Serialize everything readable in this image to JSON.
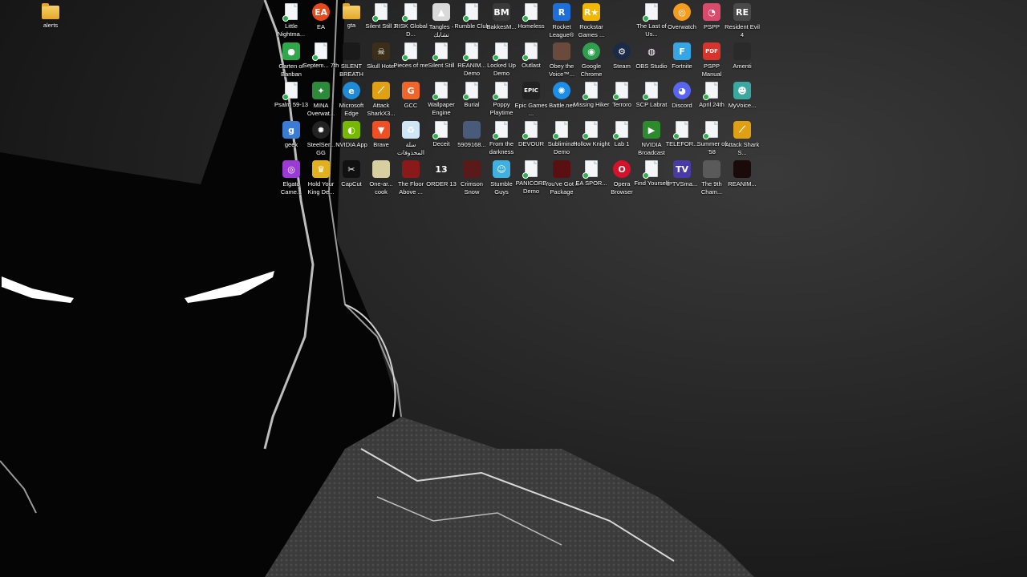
{
  "desktop": {
    "icons": [
      {
        "id": "alerts",
        "label": "alerts",
        "icon": "folder-icon",
        "kind": "folder",
        "color": "#e9b33a",
        "glyph": ""
      },
      {
        "id": "little-nightmares",
        "label": "Little Nightma...",
        "icon": "document-icon",
        "kind": "doc",
        "color": "",
        "glyph": ""
      },
      {
        "id": "ea",
        "label": "EA",
        "icon": "ea-logo-icon",
        "kind": "round",
        "color": "#e8481c",
        "glyph": "EA"
      },
      {
        "id": "gta",
        "label": "gta",
        "icon": "folder-icon",
        "kind": "folder",
        "color": "#e9b33a",
        "glyph": ""
      },
      {
        "id": "silent-still-2",
        "label": "Silent Still 2",
        "icon": "document-icon",
        "kind": "doc",
        "color": "",
        "glyph": ""
      },
      {
        "id": "risk-global",
        "label": "RISK Global D...",
        "icon": "document-icon",
        "kind": "doc",
        "color": "",
        "glyph": ""
      },
      {
        "id": "tangles",
        "label": "Tangles - تشابك",
        "icon": "tangles-icon",
        "kind": "app",
        "color": "#d9d9d9",
        "glyph": "▲"
      },
      {
        "id": "rumble-club",
        "label": "Rumble Club",
        "icon": "document-icon",
        "kind": "doc",
        "color": "",
        "glyph": ""
      },
      {
        "id": "bakkesmod",
        "label": "BakkesM...",
        "icon": "bakkesmod-icon",
        "kind": "app",
        "color": "#3a3a3a",
        "glyph": "BM"
      },
      {
        "id": "homeless",
        "label": "Homeless",
        "icon": "document-icon",
        "kind": "doc",
        "color": "",
        "glyph": ""
      },
      {
        "id": "rocket-league",
        "label": "Rocket League®",
        "icon": "rocket-league-icon",
        "kind": "app",
        "color": "#1e6fd9",
        "glyph": "R"
      },
      {
        "id": "rockstar-games",
        "label": "Rockstar Games ...",
        "icon": "rockstar-icon",
        "kind": "app",
        "color": "#f2b705",
        "glyph": "R★"
      },
      {
        "id": "the-last-of-us",
        "label": "The Last of Us...",
        "icon": "document-icon",
        "kind": "doc",
        "color": "",
        "glyph": ""
      },
      {
        "id": "overwatch",
        "label": "Overwatch",
        "icon": "overwatch-icon",
        "kind": "round",
        "color": "#f39c1e",
        "glyph": "◎"
      },
      {
        "id": "pspp",
        "label": "PSPP",
        "icon": "pspp-icon",
        "kind": "app",
        "color": "#d94b6a",
        "glyph": "◔"
      },
      {
        "id": "resident-evil-4",
        "label": "Resident Evil 4",
        "icon": "resident-evil-icon",
        "kind": "app",
        "color": "#4a4a4a",
        "glyph": "RE"
      },
      {
        "id": "garten-of-banban",
        "label": "Garten of Banban",
        "icon": "garten-icon",
        "kind": "app",
        "color": "#2fa84a",
        "glyph": "●"
      },
      {
        "id": "september-7th",
        "label": "Septem... 7th",
        "icon": "document-icon",
        "kind": "doc",
        "color": "",
        "glyph": ""
      },
      {
        "id": "silent-breath",
        "label": "SILENT BREATH",
        "icon": "silent-breath-icon",
        "kind": "app",
        "color": "#1a1a1a",
        "glyph": ""
      },
      {
        "id": "skull-hotel",
        "label": "Skull Hotel",
        "icon": "skull-hotel-icon",
        "kind": "app",
        "color": "#3b2f1a",
        "glyph": "☠"
      },
      {
        "id": "pieces-of-me",
        "label": "Pieces of me",
        "icon": "document-icon",
        "kind": "doc",
        "color": "",
        "glyph": ""
      },
      {
        "id": "silent-still",
        "label": "Silent Still",
        "icon": "document-icon",
        "kind": "doc",
        "color": "",
        "glyph": ""
      },
      {
        "id": "reanimal-demo",
        "label": "REANIM... Demo",
        "icon": "document-icon",
        "kind": "doc",
        "color": "",
        "glyph": ""
      },
      {
        "id": "locked-up-demo",
        "label": "Locked Up Demo",
        "icon": "document-icon",
        "kind": "doc",
        "color": "",
        "glyph": ""
      },
      {
        "id": "outlast",
        "label": "Outlast",
        "icon": "document-icon",
        "kind": "doc",
        "color": "",
        "glyph": ""
      },
      {
        "id": "obey-the-voice",
        "label": "Obey the Voice™...",
        "icon": "obey-voice-icon",
        "kind": "app",
        "color": "#6a4a3a",
        "glyph": ""
      },
      {
        "id": "google-chrome",
        "label": "Google Chrome",
        "icon": "chrome-icon",
        "kind": "round",
        "color": "#2f9e4f",
        "glyph": "◉"
      },
      {
        "id": "steam",
        "label": "Steam",
        "icon": "steam-icon",
        "kind": "round",
        "color": "#1b2a45",
        "glyph": "⚙"
      },
      {
        "id": "obs-studio",
        "label": "OBS Studio",
        "icon": "obs-icon",
        "kind": "round",
        "color": "#302e31",
        "glyph": "◍"
      },
      {
        "id": "fortnite",
        "label": "Fortnite",
        "icon": "fortnite-icon",
        "kind": "app",
        "color": "#34a6e6",
        "glyph": "F"
      },
      {
        "id": "pspp-manual",
        "label": "PSPP Manual",
        "icon": "pdf-icon",
        "kind": "app",
        "color": "#d9342b",
        "glyph": "PDF"
      },
      {
        "id": "amenti",
        "label": "Amenti",
        "icon": "amenti-icon",
        "kind": "app",
        "color": "#2a2a2a",
        "glyph": ""
      },
      {
        "id": "psalm-59-13",
        "label": "Psalm 59-13",
        "icon": "document-icon",
        "kind": "doc",
        "color": "",
        "glyph": ""
      },
      {
        "id": "mina-overwatch",
        "label": "MINA Overwat...",
        "icon": "mina-icon",
        "kind": "app",
        "color": "#2c8a3a",
        "glyph": "✦"
      },
      {
        "id": "microsoft-edge",
        "label": "Microsoft Edge",
        "icon": "edge-icon",
        "kind": "round",
        "color": "#1f8bd6",
        "glyph": "e"
      },
      {
        "id": "attack-shark-x3",
        "label": "Attack SharkX3...",
        "icon": "attack-shark-icon",
        "kind": "app",
        "color": "#e0a014",
        "glyph": "⟋"
      },
      {
        "id": "gcc",
        "label": "GCC",
        "icon": "gcc-icon",
        "kind": "app",
        "color": "#f0652a",
        "glyph": "G"
      },
      {
        "id": "wallpaper-engine",
        "label": "Wallpaper Engine",
        "icon": "document-icon",
        "kind": "doc",
        "color": "",
        "glyph": ""
      },
      {
        "id": "burial",
        "label": "Burial",
        "icon": "document-icon",
        "kind": "doc",
        "color": "",
        "glyph": ""
      },
      {
        "id": "poppy-playtime",
        "label": "Poppy Playtime",
        "icon": "document-icon",
        "kind": "doc",
        "color": "",
        "glyph": ""
      },
      {
        "id": "epic-games",
        "label": "Epic Games ...",
        "icon": "epic-games-icon",
        "kind": "app",
        "color": "#222222",
        "glyph": "EPIC"
      },
      {
        "id": "battle-net",
        "label": "Battle.net",
        "icon": "battlenet-icon",
        "kind": "round",
        "color": "#1b8ee8",
        "glyph": "✺"
      },
      {
        "id": "missing-hiker",
        "label": "Missing Hiker",
        "icon": "document-icon",
        "kind": "doc",
        "color": "",
        "glyph": ""
      },
      {
        "id": "terroro",
        "label": "Terroro",
        "icon": "document-icon",
        "kind": "doc",
        "color": "",
        "glyph": ""
      },
      {
        "id": "scp-labrat",
        "label": "SCP Labrat",
        "icon": "document-icon",
        "kind": "doc",
        "color": "",
        "glyph": ""
      },
      {
        "id": "discord",
        "label": "Discord",
        "icon": "discord-icon",
        "kind": "round",
        "color": "#5865f2",
        "glyph": "◕"
      },
      {
        "id": "april-24th",
        "label": "April 24th",
        "icon": "document-icon",
        "kind": "doc",
        "color": "",
        "glyph": ""
      },
      {
        "id": "myvoice",
        "label": "MyVoice...",
        "icon": "myvoice-icon",
        "kind": "app",
        "color": "#3aa7a0",
        "glyph": "☻"
      },
      {
        "id": "geek",
        "label": "geek",
        "icon": "geek-icon",
        "kind": "app",
        "color": "#3a7bd5",
        "glyph": "g"
      },
      {
        "id": "steelseries-gg",
        "label": "SteelSer... GG",
        "icon": "steelseries-icon",
        "kind": "round",
        "color": "#222222",
        "glyph": "✹"
      },
      {
        "id": "nvidia-app",
        "label": "NVIDIA App",
        "icon": "nvidia-icon",
        "kind": "app",
        "color": "#76b900",
        "glyph": "◐"
      },
      {
        "id": "brave",
        "label": "Brave",
        "icon": "brave-icon",
        "kind": "app",
        "color": "#f04f23",
        "glyph": "▼"
      },
      {
        "id": "recycle-bin",
        "label": "سلة المحذوفات",
        "icon": "recycle-bin-icon",
        "kind": "app",
        "color": "#cfe6f5",
        "glyph": "♻"
      },
      {
        "id": "deceit",
        "label": "Deceit",
        "icon": "document-icon",
        "kind": "doc",
        "color": "",
        "glyph": ""
      },
      {
        "id": "5909168",
        "label": "5909168...",
        "icon": "anime-avatar-icon",
        "kind": "app",
        "color": "#4a5a7a",
        "glyph": ""
      },
      {
        "id": "from-the-darkness",
        "label": "From the darkness",
        "icon": "document-icon",
        "kind": "doc",
        "color": "",
        "glyph": ""
      },
      {
        "id": "devour",
        "label": "DEVOUR",
        "icon": "document-icon",
        "kind": "doc",
        "color": "",
        "glyph": ""
      },
      {
        "id": "subliminal-demo",
        "label": "Subliminal Demo",
        "icon": "document-icon",
        "kind": "doc",
        "color": "",
        "glyph": ""
      },
      {
        "id": "hollow-knight",
        "label": "Hollow Knight",
        "icon": "document-icon",
        "kind": "doc",
        "color": "",
        "glyph": ""
      },
      {
        "id": "lab-1",
        "label": "Lab 1",
        "icon": "spreadsheet-icon",
        "kind": "doc",
        "color": "",
        "glyph": ""
      },
      {
        "id": "nvidia-broadcast",
        "label": "NVIDIA Broadcast",
        "icon": "nvidia-broadcast-icon",
        "kind": "app",
        "color": "#2d8a2d",
        "glyph": "▶"
      },
      {
        "id": "telefor",
        "label": "TELEFOR...",
        "icon": "document-icon",
        "kind": "doc",
        "color": "",
        "glyph": ""
      },
      {
        "id": "summer-of-58",
        "label": "Summer of '58",
        "icon": "document-icon",
        "kind": "doc",
        "color": "",
        "glyph": ""
      },
      {
        "id": "attack-shark-s",
        "label": "Attack Shark S...",
        "icon": "attack-shark-icon",
        "kind": "app",
        "color": "#e0a014",
        "glyph": "⟋"
      },
      {
        "id": "elgato-camera",
        "label": "Elgato Came...",
        "icon": "elgato-icon",
        "kind": "app",
        "color": "#9b3bd6",
        "glyph": "◎"
      },
      {
        "id": "hold-your-king",
        "label": "Hold Your King De...",
        "icon": "hold-king-icon",
        "kind": "app",
        "color": "#e0b020",
        "glyph": "♛"
      },
      {
        "id": "capcut",
        "label": "CapCut",
        "icon": "capcut-icon",
        "kind": "app",
        "color": "#111111",
        "glyph": "✂"
      },
      {
        "id": "one-armed-cook",
        "label": "One-ar... cook",
        "icon": "one-armed-cook-icon",
        "kind": "app",
        "color": "#d8cfa0",
        "glyph": ""
      },
      {
        "id": "the-floor-above",
        "label": "The Floor Above ...",
        "icon": "floor-above-icon",
        "kind": "app",
        "color": "#8a1a1a",
        "glyph": ""
      },
      {
        "id": "order-13",
        "label": "ORDER 13",
        "icon": "order-13-icon",
        "kind": "app",
        "color": "#2a2a2a",
        "glyph": "13"
      },
      {
        "id": "crimson-snow",
        "label": "Crimson Snow",
        "icon": "crimson-snow-icon",
        "kind": "app",
        "color": "#5a1a1a",
        "glyph": ""
      },
      {
        "id": "stumble-guys",
        "label": "Stumble Guys",
        "icon": "stumble-guys-icon",
        "kind": "app",
        "color": "#3fb0e0",
        "glyph": "☺"
      },
      {
        "id": "panicore-demo",
        "label": "PANICORE Demo",
        "icon": "document-icon",
        "kind": "doc",
        "color": "",
        "glyph": ""
      },
      {
        "id": "youve-got-a-package",
        "label": "You've Got a Package",
        "icon": "package-icon",
        "kind": "app",
        "color": "#5a1010",
        "glyph": ""
      },
      {
        "id": "ea-sports",
        "label": "EA SPOR...",
        "icon": "document-icon",
        "kind": "doc",
        "color": "",
        "glyph": ""
      },
      {
        "id": "opera-browser",
        "label": "Opera Browser",
        "icon": "opera-icon",
        "kind": "round",
        "color": "#d8102a",
        "glyph": "O"
      },
      {
        "id": "find-yourself",
        "label": "Find Yourself",
        "icon": "document-icon",
        "kind": "doc",
        "color": "",
        "glyph": ""
      },
      {
        "id": "iptv-smarters",
        "label": "IPTVSma...",
        "icon": "iptv-icon",
        "kind": "app",
        "color": "#4a3aa8",
        "glyph": "TV"
      },
      {
        "id": "the-9th-chamber",
        "label": "The 9th Cham...",
        "icon": "ninth-chamber-icon",
        "kind": "app",
        "color": "#5a5a5a",
        "glyph": ""
      },
      {
        "id": "reanimal",
        "label": "REANIM...",
        "icon": "reanimal-icon",
        "kind": "app",
        "color": "#1a0a0a",
        "glyph": ""
      }
    ]
  }
}
